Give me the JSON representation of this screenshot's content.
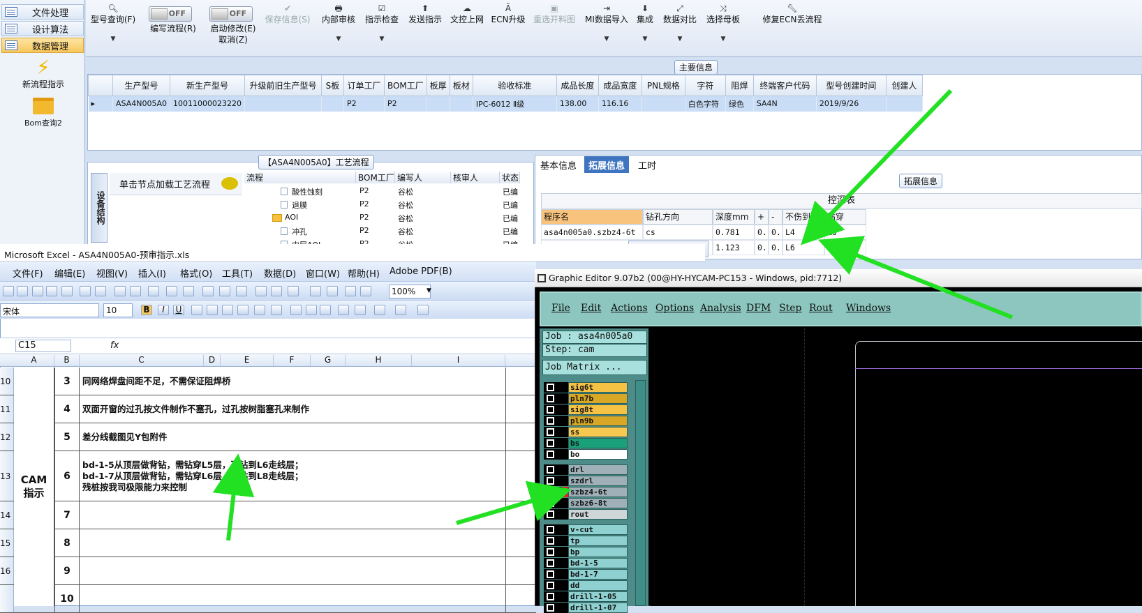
{
  "left_nav": {
    "items": [
      {
        "label": "文件处理"
      },
      {
        "label": "设计算法"
      },
      {
        "label": "数据管理",
        "active": true
      }
    ],
    "big_buttons": [
      {
        "label": "新流程指示",
        "icon": "lightning-icon"
      },
      {
        "label": "Bom查询2",
        "icon": "folder-icon"
      }
    ]
  },
  "toolbar": {
    "query": "型号查询(F)",
    "toggle1": {
      "state": "OFF",
      "label": "编写流程(R)"
    },
    "toggle2": {
      "state": "OFF",
      "label": "启动修改(E)",
      "label2": "取消(Z)"
    },
    "save": "保存信息(S)",
    "internal_review": "内部审核",
    "check": "指示检查",
    "send": "发送指示",
    "online": "文控上网",
    "ecn": "ECN升级",
    "reselect": "重选开料图",
    "mi_import": "MI数据导入",
    "integrate": "集成",
    "compare": "数据对比",
    "mother": "选择母板",
    "fix_ecn": "修复ECN丢流程"
  },
  "main_info": {
    "title": "主要信息",
    "columns": [
      "生产型号",
      "新生产型号",
      "升级前旧生产型号",
      "S板",
      "订单工厂",
      "BOM工厂",
      "板厚",
      "板材",
      "验收标准",
      "成品长度",
      "成品宽度",
      "PNL规格",
      "字符",
      "阻焊",
      "终端客户代码",
      "型号创建时间",
      "创建人"
    ],
    "row": [
      "ASA4N005A0",
      "10011000023220",
      "",
      "",
      "P2",
      "P2",
      "",
      "",
      "IPC-6012 Ⅱ级",
      "138.00",
      "116.16",
      "",
      "白色字符",
      "绿色",
      "SA4N",
      "2019/9/26",
      ""
    ]
  },
  "workflow": {
    "title": "【ASA4N005A0】工艺流程",
    "vertical_tab": "设备结构",
    "click_hint": "单击节点加载工艺流程",
    "columns": [
      "流程",
      "BOM工厂",
      "编写人",
      "核审人",
      "状态"
    ],
    "rows": [
      {
        "name": "酸性蚀刻",
        "bom": "P2",
        "writer": "谷松",
        "status": "已编"
      },
      {
        "name": "退膜",
        "bom": "P2",
        "writer": "谷松",
        "status": "已编"
      },
      {
        "name": "AOI",
        "bom": "P2",
        "writer": "谷松",
        "status": "已编"
      },
      {
        "name": "冲孔",
        "bom": "P2",
        "writer": "谷松",
        "status": "已编"
      },
      {
        "name": "内层AOI",
        "bom": "P2",
        "writer": "谷松",
        "status": "已编"
      }
    ]
  },
  "right_panel": {
    "tabs": [
      "基本信息",
      "拓展信息",
      "工时"
    ],
    "active_tab": "拓展信息",
    "section_title": "拓展信息",
    "table_title": "控深表",
    "columns": [
      "程序名",
      "钻孔方向",
      "深度mm",
      "+",
      "-",
      "不伤到",
      "钻穿"
    ],
    "rows": [
      [
        "asa4n005a0.szbz4-6t",
        "cs",
        "0.781",
        "0..",
        "0..",
        "L4",
        "L6"
      ],
      [
        "",
        "",
        "1.123",
        "0..",
        "0..",
        "L6",
        "L8"
      ]
    ]
  },
  "excel": {
    "title": "Microsoft Excel - ASA4N005A0-预审指示.xls",
    "menu": [
      "文件(F)",
      "编辑(E)",
      "视图(V)",
      "插入(I)",
      "格式(O)",
      "工具(T)",
      "数据(D)",
      "窗口(W)",
      "帮助(H)",
      "Adobe PDF(B)"
    ],
    "zoom": "100%",
    "font": "宋体",
    "font_size": "10",
    "cell_ref": "C15",
    "fx": "fx",
    "columns": [
      "A",
      "B",
      "C",
      "D",
      "E",
      "F",
      "G",
      "H",
      "I"
    ],
    "cam_label": "CAM\n指示",
    "rows": [
      {
        "rownum": "10",
        "no": "3",
        "text": "同网络焊盘间距不足，不需保证阻焊桥"
      },
      {
        "rownum": "11",
        "no": "4",
        "text": "双面开窗的过孔按文件制作不塞孔，过孔按树脂塞孔来制作"
      },
      {
        "rownum": "12",
        "no": "5",
        "text": "差分线截图见Y包附件"
      },
      {
        "rownum": "13",
        "no": "6",
        "text": "bd-1-5从顶层做背钻，需钻穿L5层，不钻到L6走线层；\nbd-1-7从顶层做背钻，需钻穿L6层，不钻到L8走线层；\n残桩按我司极限能力来控制"
      },
      {
        "rownum": "14",
        "no": "7",
        "text": ""
      },
      {
        "rownum": "15",
        "no": "8",
        "text": ""
      },
      {
        "rownum": "16",
        "no": "9",
        "text": ""
      },
      {
        "rownum": "",
        "no": "10",
        "text": ""
      }
    ]
  },
  "graphic_editor": {
    "title": "Graphic Editor 9.07b2 (00@HY-HYCAM-PC153 - Windows, pid:7712)",
    "menu": [
      "File",
      "Edit",
      "Actions",
      "Options",
      "Analysis",
      "DFM",
      "Step",
      "Rout",
      "Windows"
    ],
    "job": "Job : asa4n005a0",
    "step": "Step: cam",
    "matrix_button": "Job Matrix ...",
    "layers": [
      {
        "name": "sig6t",
        "color": "#f6c244"
      },
      {
        "name": "pln7b",
        "color": "#d8a726"
      },
      {
        "name": "sig8t",
        "color": "#f6c244"
      },
      {
        "name": "pln9b",
        "color": "#d8a726"
      },
      {
        "name": "ss",
        "color": "#f9c84e"
      },
      {
        "name": "bs",
        "color": "#1aa17a"
      },
      {
        "name": "bo",
        "color": "#ffffff"
      },
      {
        "name": "drl",
        "color": "#9fb0b8"
      },
      {
        "name": "szdrl",
        "color": "#9fb0b8"
      },
      {
        "name": "szbz4-6t",
        "color": "#9fb0b8",
        "marked": true
      },
      {
        "name": "szbz6-8t",
        "color": "#9fb0b8"
      },
      {
        "name": "rout",
        "color": "#cfd6d8"
      },
      {
        "name": "v-cut",
        "color": "#8fd0d0"
      },
      {
        "name": "tp",
        "color": "#8fd0d0"
      },
      {
        "name": "bp",
        "color": "#8fd0d0"
      },
      {
        "name": "bd-1-5",
        "color": "#8fd0d0"
      },
      {
        "name": "bd-1-7",
        "color": "#8fd0d0"
      },
      {
        "name": "dd",
        "color": "#8fd0d0"
      },
      {
        "name": "drill-1-05",
        "color": "#8fd0d0"
      },
      {
        "name": "drill-1-07",
        "color": "#8fd0d0"
      }
    ]
  },
  "colors": {
    "arrow": "#22e022",
    "accent": "#3f74c0"
  }
}
